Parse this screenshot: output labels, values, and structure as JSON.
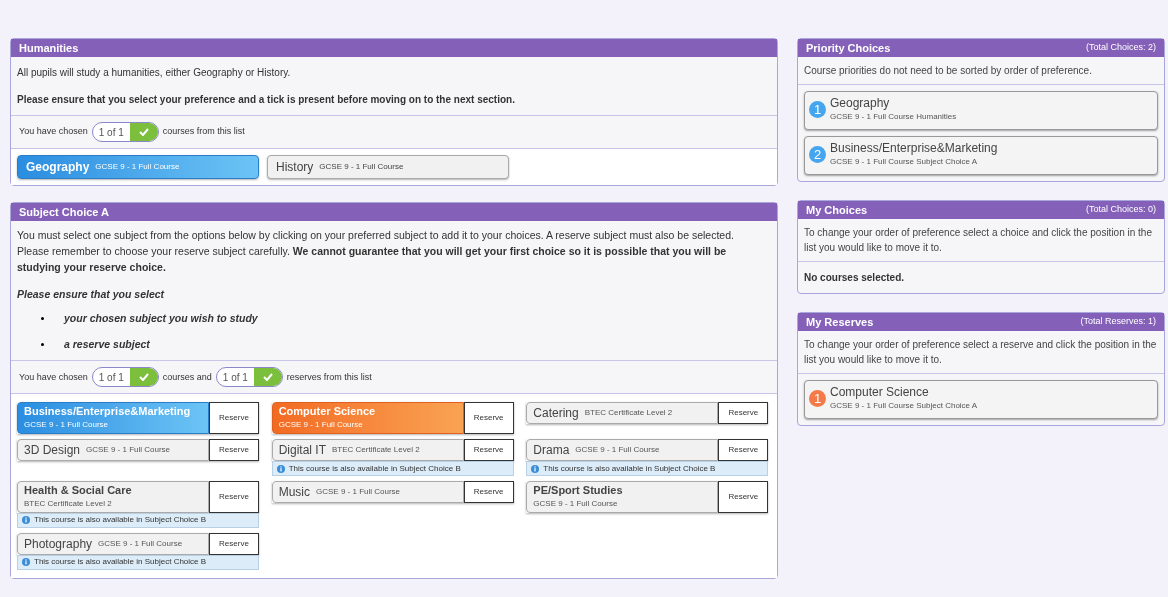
{
  "humanities": {
    "title": "Humanities",
    "lines": [
      {
        "text": "All pupils will study a humanities, either Geography or History.",
        "kind": "plain"
      },
      {
        "text": "Please ensure that you select your preference and a tick is present before moving on to the next section.",
        "kind": "bold"
      }
    ],
    "counter": {
      "prefix": "You have chosen",
      "pills": [
        {
          "text": "1 of 1",
          "complete": true,
          "after": "courses from this list"
        }
      ]
    },
    "courses": [
      {
        "name": "Geography",
        "detail": "GCSE 9 - 1 Full Course",
        "selected": true
      },
      {
        "name": "History",
        "detail": "GCSE 9 - 1 Full Course",
        "selected": false
      }
    ]
  },
  "subject_choice": {
    "title": "Subject Choice A",
    "paragraph": "You must select one subject from the options below by clicking on your preferred subject to add it to your choices.  A reserve subject must also be selected. Please remember to choose your reserve subject carefully. **We cannot guarantee that you will get your first choice so it is possible that you will be studying your reserve choice.**",
    "ensure": "Please ensure that you select",
    "bullets": [
      "your chosen subject you wish to study",
      "a reserve subject"
    ],
    "counter": {
      "prefix": "You have chosen",
      "pills": [
        {
          "text": "1 of 1",
          "complete": true,
          "after": "courses and"
        },
        {
          "text": "1 of 1",
          "complete": true,
          "after": "reserves from this list"
        }
      ]
    },
    "rows": [
      [
        {
          "name": "Business/Enterprise&Marketing",
          "detail": "GCSE 9 - 1 Full Course",
          "kind": "stacked",
          "selected": true,
          "reserved": false,
          "button": "Reserve"
        },
        {
          "name": "Computer Science",
          "detail": "GCSE 9 - 1 Full Course",
          "kind": "stacked",
          "selected": false,
          "reserved": true,
          "button": "Reserve"
        },
        {
          "name": "Catering",
          "detail": "BTEC Certificate Level 2",
          "kind": "inline",
          "selected": false,
          "reserved": false,
          "button": "Reserve"
        }
      ],
      [
        {
          "name": "3D Design",
          "detail": "GCSE 9 - 1 Full Course",
          "kind": "inline",
          "selected": false,
          "reserved": false,
          "button": "Reserve"
        },
        {
          "name": "Digital IT",
          "detail": "BTEC Certificate Level 2",
          "kind": "inline",
          "selected": false,
          "reserved": false,
          "button": "Reserve",
          "note": "This course is also available in Subject Choice B"
        },
        {
          "name": "Drama",
          "detail": "GCSE 9 - 1 Full Course",
          "kind": "inline",
          "selected": false,
          "reserved": false,
          "button": "Reserve",
          "note": "This course is also available in Subject Choice B"
        }
      ],
      [
        {
          "name": "Health & Social Care",
          "detail": "BTEC Certificate Level 2",
          "kind": "stacked",
          "selected": false,
          "reserved": false,
          "button": "Reserve",
          "note": "This course is also available in Subject Choice B"
        },
        {
          "name": "Music",
          "detail": "GCSE 9 - 1 Full Course",
          "kind": "inline",
          "selected": false,
          "reserved": false,
          "button": "Reserve"
        },
        {
          "name": "PE/Sport Studies",
          "detail": "GCSE 9 - 1 Full Course",
          "kind": "stacked",
          "selected": false,
          "reserved": false,
          "button": "Reserve"
        }
      ],
      [
        {
          "name": "Photography",
          "detail": "GCSE 9 - 1 Full Course",
          "kind": "inline",
          "selected": false,
          "reserved": false,
          "button": "Reserve",
          "note": "This course is also available in Subject Choice B"
        }
      ]
    ]
  },
  "side_panels": [
    {
      "title": "Priority Choices",
      "total": "(Total Choices: 2)",
      "description": "Course priorities do not need to be sorted by order of preference.",
      "kind": "choice",
      "items": [
        {
          "number": "1",
          "name": "Geography",
          "detail": "GCSE 9 - 1 Full Course Humanities"
        },
        {
          "number": "2",
          "name": "Business/Enterprise&Marketing",
          "detail": "GCSE 9 - 1 Full Course Subject Choice A"
        }
      ]
    },
    {
      "title": "My Choices",
      "total": "(Total Choices: 0)",
      "description": "To change your order of preference select a choice and click the position in the list you would like to move it to.",
      "empty": "No courses selected."
    },
    {
      "title": "My Reserves",
      "total": "(Total Reserves: 1)",
      "description": "To change your order of preference select a reserve and click the position in the list you would like to move it to.",
      "kind": "reserve",
      "items": [
        {
          "number": "1",
          "name": "Computer Science",
          "detail": "GCSE 9 - 1 Full Course Subject Choice A"
        }
      ]
    }
  ]
}
